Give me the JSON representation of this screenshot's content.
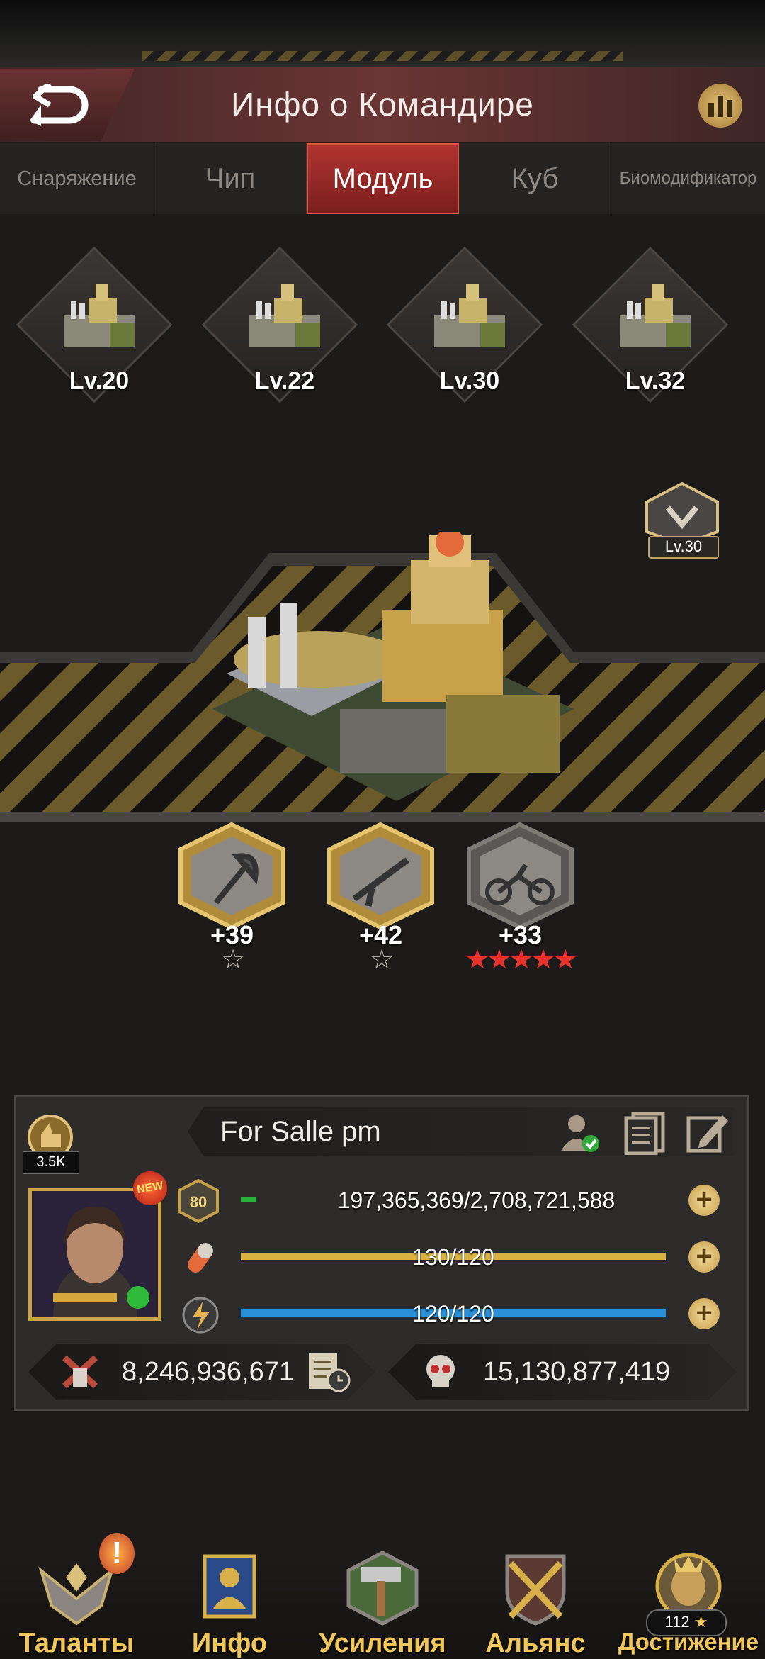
{
  "header": {
    "title": "Инфо о Командире"
  },
  "tabs": [
    {
      "label": "Снаряжение",
      "active": false
    },
    {
      "label": "Чип",
      "active": false
    },
    {
      "label": "Модуль",
      "active": true
    },
    {
      "label": "Куб",
      "active": false
    },
    {
      "label": "Биомодификатор",
      "active": false
    }
  ],
  "modules": [
    {
      "level": "Lv.20"
    },
    {
      "level": "Lv.22"
    },
    {
      "level": "Lv.30"
    },
    {
      "level": "Lv.32"
    }
  ],
  "selected_module": {
    "level": "Lv.30"
  },
  "skills": [
    {
      "value": "+39",
      "icon": "axe-icon",
      "stars": "☆",
      "star_color": "#b9b2a8"
    },
    {
      "value": "+42",
      "icon": "rifle-icon",
      "stars": "☆",
      "star_color": "#b9b2a8"
    },
    {
      "value": "+33",
      "icon": "motorcycle-icon",
      "stars": "★★★★★",
      "star_color": "#e8322b"
    }
  ],
  "player": {
    "name": "For Salle pm",
    "power": "3.5K",
    "new_badge": "NEW",
    "level": "80",
    "experience": "197,365,369/2,708,721,588",
    "experience_fraction": 0.073,
    "stamina": "130/120",
    "stamina_fraction": 1.0,
    "energy": "120/120",
    "energy_fraction": 1.0,
    "kills": "8,246,936,671",
    "losses": "15,130,877,419"
  },
  "bottom_nav": [
    {
      "label": "Таланты",
      "icon": "talents-icon"
    },
    {
      "label": "Инфо",
      "icon": "info-icon"
    },
    {
      "label": "Усиления",
      "icon": "boost-icon"
    },
    {
      "label": "Альянс",
      "icon": "alliance-icon"
    },
    {
      "label": "Достижение",
      "icon": "achievement-icon"
    }
  ],
  "alert": "!",
  "achievement_count": "112",
  "colors": {
    "accent_gold": "#f1c65a",
    "tab_active": "#b03330",
    "exp_bar": "#27b33a",
    "stamina_bar": "#d9b341",
    "energy_bar": "#2a8fd6"
  }
}
